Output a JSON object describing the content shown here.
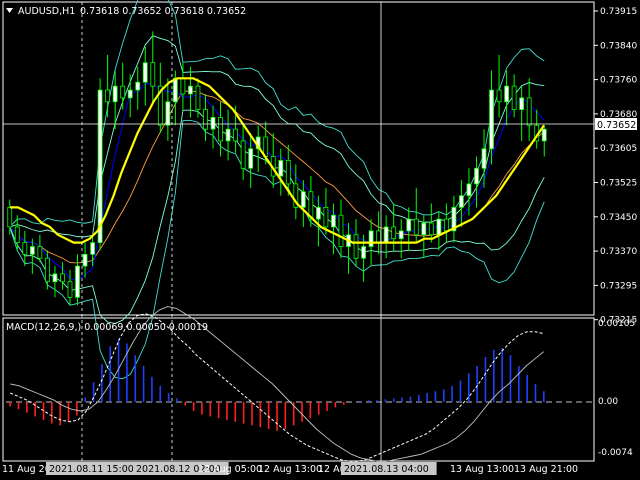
{
  "window": {
    "symbol_label": "AUDUSD,H1",
    "ohlc_label": "0.73618 0.73652 0.73618 0.73652",
    "macd_label": "MACD(12,26,9,) 0.00069 0.00050 0.00019",
    "current_price": "0.73652"
  },
  "colors": {
    "bg": "#000000",
    "bull_candle": "#ffffff",
    "bear_candle": "#000000",
    "wick": "#00ff00",
    "ma_slow": "#ffff00",
    "bb_outer": "#40e0d0",
    "bb_inner": "#7fffd4",
    "ma_fast": "#0000ff",
    "ma_mid": "#ffa040",
    "macd_pos": "#2040ff",
    "macd_neg": "#ff2020",
    "macd_signal": "#ffffff",
    "macd_main": "#c0c0c0"
  },
  "chart_data": [
    {
      "type": "candlestick",
      "ylim": [
        0.7318,
        0.7397
      ],
      "y_ticks": [
        "0.73915",
        "0.73840",
        "0.73760",
        "0.73680",
        "0.73605",
        "0.73525",
        "0.73450",
        "0.73370",
        "0.73295",
        "0.73215"
      ],
      "time_labels": [
        "11 Aug 2021",
        "2021.08.11 15:00",
        "2021.08.12 02:00",
        "12 Aug 05:00",
        "12 Aug 13:00",
        "12 Aug 21:00",
        "2021.08.13 04:00",
        "13 Aug 13:00",
        "13 Aug 21:00"
      ],
      "highlighted_time_labels": [
        "2021.08.11 15:00",
        "2021.08.12 02:00",
        "2021.08.13 04:00"
      ],
      "candles": [
        [
          0.7345,
          0.7347,
          0.7338,
          0.734
        ],
        [
          0.734,
          0.7343,
          0.7334,
          0.7336
        ],
        [
          0.7336,
          0.7339,
          0.733,
          0.7333
        ],
        [
          0.7333,
          0.7337,
          0.7328,
          0.7335
        ],
        [
          0.7335,
          0.7338,
          0.7331,
          0.7332
        ],
        [
          0.7332,
          0.7334,
          0.7324,
          0.7326
        ],
        [
          0.7326,
          0.733,
          0.7322,
          0.7328
        ],
        [
          0.7328,
          0.7331,
          0.7324,
          0.7326
        ],
        [
          0.7326,
          0.7329,
          0.732,
          0.7322
        ],
        [
          0.7322,
          0.7333,
          0.732,
          0.733
        ],
        [
          0.733,
          0.7336,
          0.7327,
          0.7333
        ],
        [
          0.7333,
          0.7338,
          0.733,
          0.7336
        ],
        [
          0.7336,
          0.7378,
          0.7334,
          0.7375
        ],
        [
          0.7375,
          0.7384,
          0.7368,
          0.7372
        ],
        [
          0.7372,
          0.738,
          0.7365,
          0.7376
        ],
        [
          0.7376,
          0.7382,
          0.737,
          0.7373
        ],
        [
          0.7373,
          0.7379,
          0.7368,
          0.7375
        ],
        [
          0.7375,
          0.7381,
          0.737,
          0.7377
        ],
        [
          0.7377,
          0.7386,
          0.7371,
          0.7382
        ],
        [
          0.7382,
          0.739,
          0.7372,
          0.7376
        ],
        [
          0.7376,
          0.7382,
          0.7364,
          0.7366
        ],
        [
          0.7366,
          0.7378,
          0.7362,
          0.7372
        ],
        [
          0.7372,
          0.738,
          0.7366,
          0.7378
        ],
        [
          0.7378,
          0.7382,
          0.737,
          0.7374
        ],
        [
          0.7374,
          0.7381,
          0.7368,
          0.7376
        ],
        [
          0.7376,
          0.7378,
          0.7368,
          0.737
        ],
        [
          0.737,
          0.7374,
          0.7362,
          0.7365
        ],
        [
          0.7365,
          0.7371,
          0.736,
          0.7368
        ],
        [
          0.7368,
          0.7372,
          0.7358,
          0.7362
        ],
        [
          0.7362,
          0.737,
          0.7357,
          0.7365
        ],
        [
          0.7365,
          0.7371,
          0.7359,
          0.7362
        ],
        [
          0.7362,
          0.7366,
          0.7352,
          0.7355
        ],
        [
          0.7355,
          0.7364,
          0.735,
          0.736
        ],
        [
          0.736,
          0.7366,
          0.7354,
          0.7363
        ],
        [
          0.7363,
          0.7367,
          0.7356,
          0.7358
        ],
        [
          0.7358,
          0.7364,
          0.735,
          0.7353
        ],
        [
          0.7353,
          0.736,
          0.7348,
          0.7357
        ],
        [
          0.7357,
          0.7361,
          0.7348,
          0.7351
        ],
        [
          0.7351,
          0.7356,
          0.7342,
          0.7345
        ],
        [
          0.7345,
          0.7352,
          0.734,
          0.7349
        ],
        [
          0.7349,
          0.7353,
          0.734,
          0.7342
        ],
        [
          0.7342,
          0.7348,
          0.7335,
          0.7345
        ],
        [
          0.7345,
          0.735,
          0.7338,
          0.734
        ],
        [
          0.734,
          0.7346,
          0.7333,
          0.7343
        ],
        [
          0.7343,
          0.7347,
          0.7332,
          0.7335
        ],
        [
          0.7335,
          0.7341,
          0.7328,
          0.7338
        ],
        [
          0.7338,
          0.7342,
          0.733,
          0.7332
        ],
        [
          0.7332,
          0.7338,
          0.7326,
          0.7335
        ],
        [
          0.7335,
          0.7342,
          0.733,
          0.7339
        ],
        [
          0.7339,
          0.7344,
          0.7333,
          0.7336
        ],
        [
          0.7336,
          0.7343,
          0.7332,
          0.734
        ],
        [
          0.734,
          0.7346,
          0.7334,
          0.7337
        ],
        [
          0.7337,
          0.7342,
          0.7332,
          0.7339
        ],
        [
          0.7339,
          0.7345,
          0.7334,
          0.7342
        ],
        [
          0.7342,
          0.735,
          0.7336,
          0.7338
        ],
        [
          0.7338,
          0.7343,
          0.7332,
          0.7341
        ],
        [
          0.7341,
          0.7346,
          0.7336,
          0.7338
        ],
        [
          0.7338,
          0.7344,
          0.7334,
          0.7342
        ],
        [
          0.7342,
          0.7346,
          0.7336,
          0.7339
        ],
        [
          0.7339,
          0.7348,
          0.7336,
          0.7345
        ],
        [
          0.7345,
          0.7352,
          0.734,
          0.7348
        ],
        [
          0.7348,
          0.7355,
          0.7343,
          0.7351
        ],
        [
          0.7351,
          0.7358,
          0.7345,
          0.7355
        ],
        [
          0.7355,
          0.7365,
          0.735,
          0.736
        ],
        [
          0.736,
          0.738,
          0.7356,
          0.7375
        ],
        [
          0.7375,
          0.7384,
          0.7368,
          0.7372
        ],
        [
          0.7372,
          0.738,
          0.7366,
          0.7376
        ],
        [
          0.7376,
          0.7379,
          0.7368,
          0.737
        ],
        [
          0.737,
          0.7376,
          0.7362,
          0.7373
        ],
        [
          0.7373,
          0.7378,
          0.7362,
          0.7366
        ],
        [
          0.7366,
          0.737,
          0.736,
          0.7362
        ],
        [
          0.7362,
          0.7366,
          0.7358,
          0.7365
        ]
      ],
      "ma_slow": [
        0.7345,
        0.7345,
        0.7344,
        0.7343,
        0.7341,
        0.734,
        0.7338,
        0.7337,
        0.7336,
        0.7336,
        0.7337,
        0.7339,
        0.7343,
        0.7348,
        0.7354,
        0.7359,
        0.7364,
        0.7368,
        0.7372,
        0.7375,
        0.7377,
        0.7378,
        0.7378,
        0.7378,
        0.7377,
        0.7376,
        0.7374,
        0.7372,
        0.737,
        0.7367,
        0.7364,
        0.7361,
        0.7358,
        0.7355,
        0.7352,
        0.7349,
        0.7346,
        0.7344,
        0.7342,
        0.734,
        0.7339,
        0.7338,
        0.7337,
        0.7336,
        0.7336,
        0.7336,
        0.7336,
        0.7336,
        0.7336,
        0.7336,
        0.7336,
        0.7336,
        0.7337,
        0.7337,
        0.7338,
        0.7339,
        0.734,
        0.7341,
        0.7342,
        0.7344,
        0.7346,
        0.7348,
        0.7351,
        0.7354,
        0.7357,
        0.736,
        0.7363,
        0.7366
      ],
      "macd": {
        "ylim": [
          -0.008,
          0.0105
        ],
        "y_ticks": [
          "0.00105",
          "0.00",
          "-0.0074"
        ],
        "histogram": [
          -5e-05,
          -8e-05,
          -0.00012,
          -0.00016,
          -0.0002,
          -0.00024,
          -0.00026,
          -0.00022,
          -0.00015,
          5e-05,
          0.00022,
          0.00042,
          0.00062,
          0.0007,
          0.00065,
          0.00052,
          0.0004,
          0.00028,
          0.00018,
          0.0001,
          4e-05,
          -4e-05,
          -0.0001,
          -0.00014,
          -0.00016,
          -0.00018,
          -0.0002,
          -0.00022,
          -0.00024,
          -0.00026,
          -0.00028,
          -0.0003,
          -0.00032,
          -0.0003,
          -0.00026,
          -0.00022,
          -0.00018,
          -0.00014,
          -0.0001,
          -6e-05,
          -3e-05,
          0.0,
          1e-05,
          2e-05,
          2e-05,
          3e-05,
          4e-05,
          5e-05,
          6e-05,
          8e-05,
          0.0001,
          0.00012,
          0.00014,
          0.00018,
          0.00024,
          0.00032,
          0.0004,
          0.0005,
          0.00058,
          0.0006,
          0.00052,
          0.0004,
          0.0003,
          0.0002,
          0.00012
        ],
        "signal": [
          0.0001,
          6e-05,
          2e-05,
          -4e-05,
          -0.0001,
          -0.00016,
          -0.0002,
          -0.00022,
          -0.0002,
          -0.0001,
          8e-05,
          0.00028,
          0.0005,
          0.00072,
          0.00088,
          0.00096,
          0.00098,
          0.00095,
          0.00088,
          0.0008,
          0.0007,
          0.00062,
          0.00052,
          0.00044,
          0.00036,
          0.00028,
          0.0002,
          0.00012,
          4e-05,
          -4e-05,
          -0.00012,
          -0.0002,
          -0.00028,
          -0.00036,
          -0.00042,
          -0.00048,
          -0.00052,
          -0.00056,
          -0.0006,
          -0.00064,
          -0.00066,
          -0.00066,
          -0.00064,
          -0.0006,
          -0.00056,
          -0.00052,
          -0.00048,
          -0.00044,
          -0.0004,
          -0.00036,
          -0.0003,
          -0.00022,
          -0.00014,
          -6e-05,
          4e-05,
          0.00016,
          0.0003,
          0.00044,
          0.00056,
          0.00066,
          0.00074,
          0.00078,
          0.00078,
          0.00076
        ],
        "main": [
          0.0002,
          0.00018,
          0.00014,
          0.0001,
          6e-05,
          2e-05,
          -4e-05,
          -8e-05,
          -0.0001,
          -8e-05,
          0.0,
          0.00014,
          0.0003,
          0.00048,
          0.00066,
          0.00082,
          0.00094,
          0.00102,
          0.00106,
          0.00104,
          0.00098,
          0.00092,
          0.00084,
          0.00076,
          0.00068,
          0.0006,
          0.00052,
          0.00044,
          0.00036,
          0.00028,
          0.0002,
          0.0001,
          0.0,
          -0.0001,
          -0.0002,
          -0.0003,
          -0.00038,
          -0.00046,
          -0.00052,
          -0.00058,
          -0.00062,
          -0.00064,
          -0.00066,
          -0.00066,
          -0.00064,
          -0.00062,
          -0.0006,
          -0.00058,
          -0.00054,
          -0.0005,
          -0.00046,
          -0.0004,
          -0.00032,
          -0.00022,
          -0.0001,
          2e-05,
          0.00012,
          0.0002,
          0.0003,
          0.0004,
          0.00048,
          0.00056
        ]
      }
    }
  ]
}
